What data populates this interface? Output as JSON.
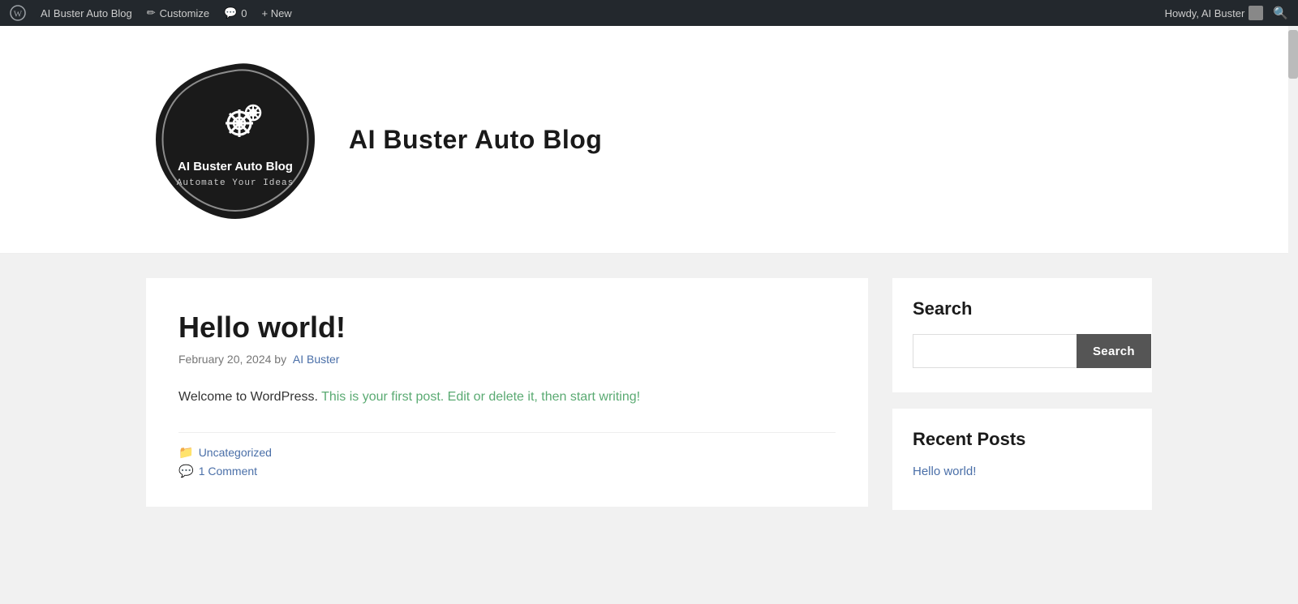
{
  "adminBar": {
    "wpLabel": "WordPress",
    "siteLabel": "AI Buster Auto Blog",
    "customizeLabel": "Customize",
    "commentsLabel": "0",
    "newLabel": "+ New",
    "howdyLabel": "Howdy, AI Buster",
    "editIcon": "✏",
    "commentIcon": "💬",
    "searchIcon": "🔍"
  },
  "header": {
    "siteTitle": "AI Buster Auto Blog",
    "siteTagline": "Automate Your Ideas",
    "logoAlt": "AI Buster Auto Blog Logo"
  },
  "post": {
    "title": "Hello world!",
    "meta": "February 20, 2024 by",
    "authorName": "AI Buster",
    "contentBefore": "Welcome to WordPress.",
    "contentHighlight": " This is your first post. Edit or delete it, then start writing!",
    "category": "Uncategorized",
    "comments": "1 Comment"
  },
  "sidebar": {
    "searchWidgetTitle": "Search",
    "searchPlaceholder": "",
    "searchButtonLabel": "Search",
    "recentPostsTitle": "Recent Posts",
    "recentPosts": [
      {
        "title": "Hello world!",
        "url": "#"
      }
    ]
  }
}
